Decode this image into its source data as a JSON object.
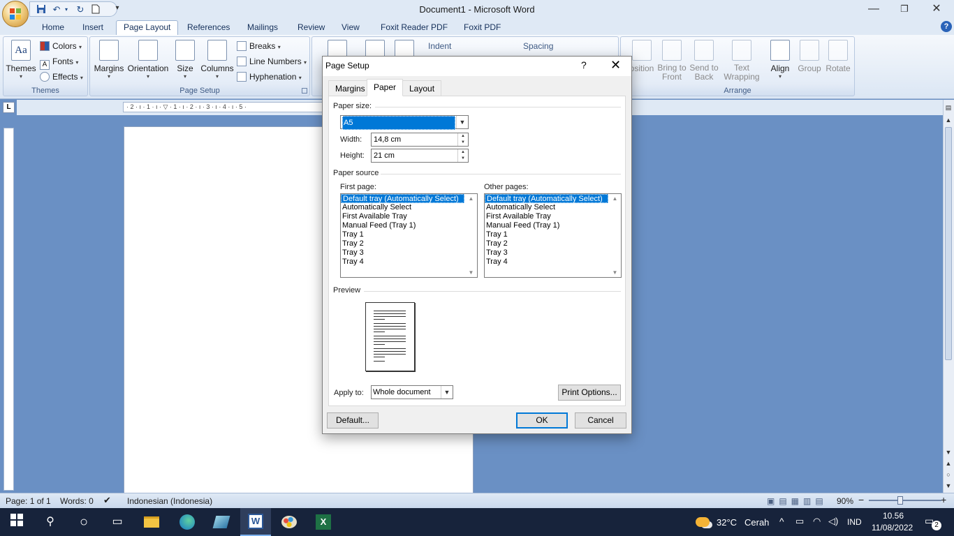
{
  "window": {
    "title": "Document1 - Microsoft Word",
    "minimize": "—",
    "restore": "❐",
    "close": "✕"
  },
  "qat": [
    "save-icon",
    "undo-icon",
    "redo-icon",
    "new-icon"
  ],
  "tabs": [
    "Home",
    "Insert",
    "Page Layout",
    "References",
    "Mailings",
    "Review",
    "View",
    "Foxit Reader PDF",
    "Foxit PDF"
  ],
  "active_tab": "Page Layout",
  "help_label": "?",
  "ribbon": {
    "themes": {
      "label": "Themes",
      "group": "Themes",
      "colors": "Colors",
      "fonts": "Fonts",
      "effects": "Effects"
    },
    "page_setup": {
      "group": "Page Setup",
      "margins": "Margins",
      "orientation": "Orientation",
      "size": "Size",
      "columns": "Columns",
      "breaks": "Breaks",
      "line_numbers": "Line Numbers",
      "hyphenation": "Hyphenation"
    },
    "paragraph": {
      "indent": "Indent",
      "spacing": "Spacing"
    },
    "arrange": {
      "group": "Arrange",
      "position": "osition",
      "bring_to_front_1": "Bring to",
      "bring_to_front_2": "Front",
      "send_to_back_1": "Send to",
      "send_to_back_2": "Back",
      "text_wrapping_1": "Text",
      "text_wrapping_2": "Wrapping",
      "align": "Align",
      "group_btn": "Group",
      "rotate": "Rotate"
    }
  },
  "ruler": {
    "marks": "· 2 · ı · 1 · ı · ▽ · 1 · ı · 2 · ı · 3 · ı · 4 · ı · 5 ·",
    "tab_selector": "L"
  },
  "dialog": {
    "title": "Page Setup",
    "help": "?",
    "close": "✕",
    "tabs": [
      "Margins",
      "Paper",
      "Layout"
    ],
    "active_tab": "Paper",
    "paper_size_label": "Paper size:",
    "paper_size_value": "A5",
    "width_label": "Width:",
    "width_value": "14,8 cm",
    "height_label": "Height:",
    "height_value": "21 cm",
    "paper_source_label": "Paper source",
    "first_page_label": "First page:",
    "other_pages_label": "Other pages:",
    "trays": [
      "Default tray (Automatically Select)",
      "Automatically Select",
      "First Available Tray",
      "Manual Feed (Tray 1)",
      "Tray 1",
      "Tray 2",
      "Tray 3",
      "Tray 4"
    ],
    "selected_tray_index": 0,
    "preview_label": "Preview",
    "apply_to_label": "Apply to:",
    "apply_to_value": "Whole document",
    "print_options": "Print Options...",
    "default_button": "Default...",
    "ok": "OK",
    "cancel": "Cancel"
  },
  "status": {
    "page": "Page: 1 of 1",
    "words": "Words: 0",
    "language": "Indonesian (Indonesia)",
    "zoom": "90%",
    "zoom_out": "−",
    "zoom_in": "+"
  },
  "taskbar": {
    "weather_temp": "32°C",
    "weather_text": "Cerah",
    "lang": "IND",
    "time": "10.56",
    "date": "11/08/2022",
    "notifications": "2"
  }
}
